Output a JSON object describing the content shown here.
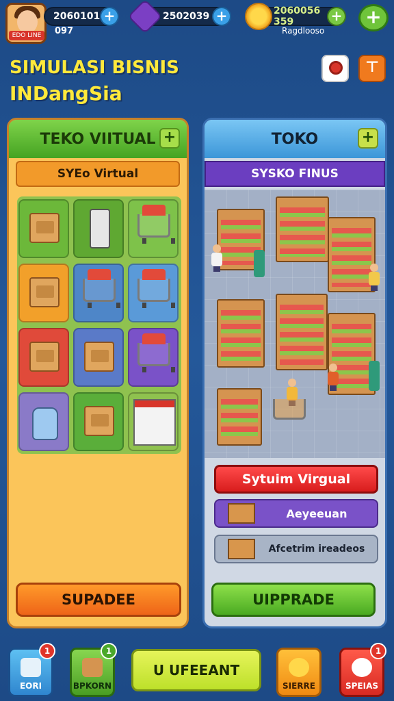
{
  "player": {
    "avatar_tag": "EDO LINE",
    "level_sub": "097"
  },
  "currencies": {
    "coins": "2060101",
    "gems": "2502039",
    "gold": "2060056 359",
    "rank_label": "Ragdlooso"
  },
  "title": {
    "line1": "SIMULASI BISNIS",
    "line2": "INDangSia"
  },
  "left_panel": {
    "header": "TEKO VIITUAL",
    "subheader": "SYEo Virtual",
    "tiles": [
      "box-veg",
      "device",
      "cart",
      "box",
      "cart-veg",
      "cart",
      "box",
      "crate",
      "cart",
      "bottle",
      "crate-veg",
      "shop"
    ],
    "button": "SUPADEE"
  },
  "right_panel": {
    "header": "TOKO",
    "subheader": "SYSKO FINUS",
    "rows": {
      "red": "Sytuim Virgual",
      "purple": "Aeyeeuan",
      "grey": "Afcetrim ireadeos"
    },
    "button": "UIPPRADE"
  },
  "bottom_nav": {
    "btn1": {
      "label": "EORI",
      "badge": "1"
    },
    "btn2": {
      "label": "BPKORN",
      "badge": "1"
    },
    "center": "U UFEEANT",
    "btn4": {
      "label": "SIERRE"
    },
    "btn5": {
      "label": "SPEIAS",
      "badge": "1"
    }
  },
  "colors": {
    "background": "#1f4e8c",
    "title": "#ffe93b",
    "left_header": "#45a322",
    "right_header": "#3c96d8"
  }
}
